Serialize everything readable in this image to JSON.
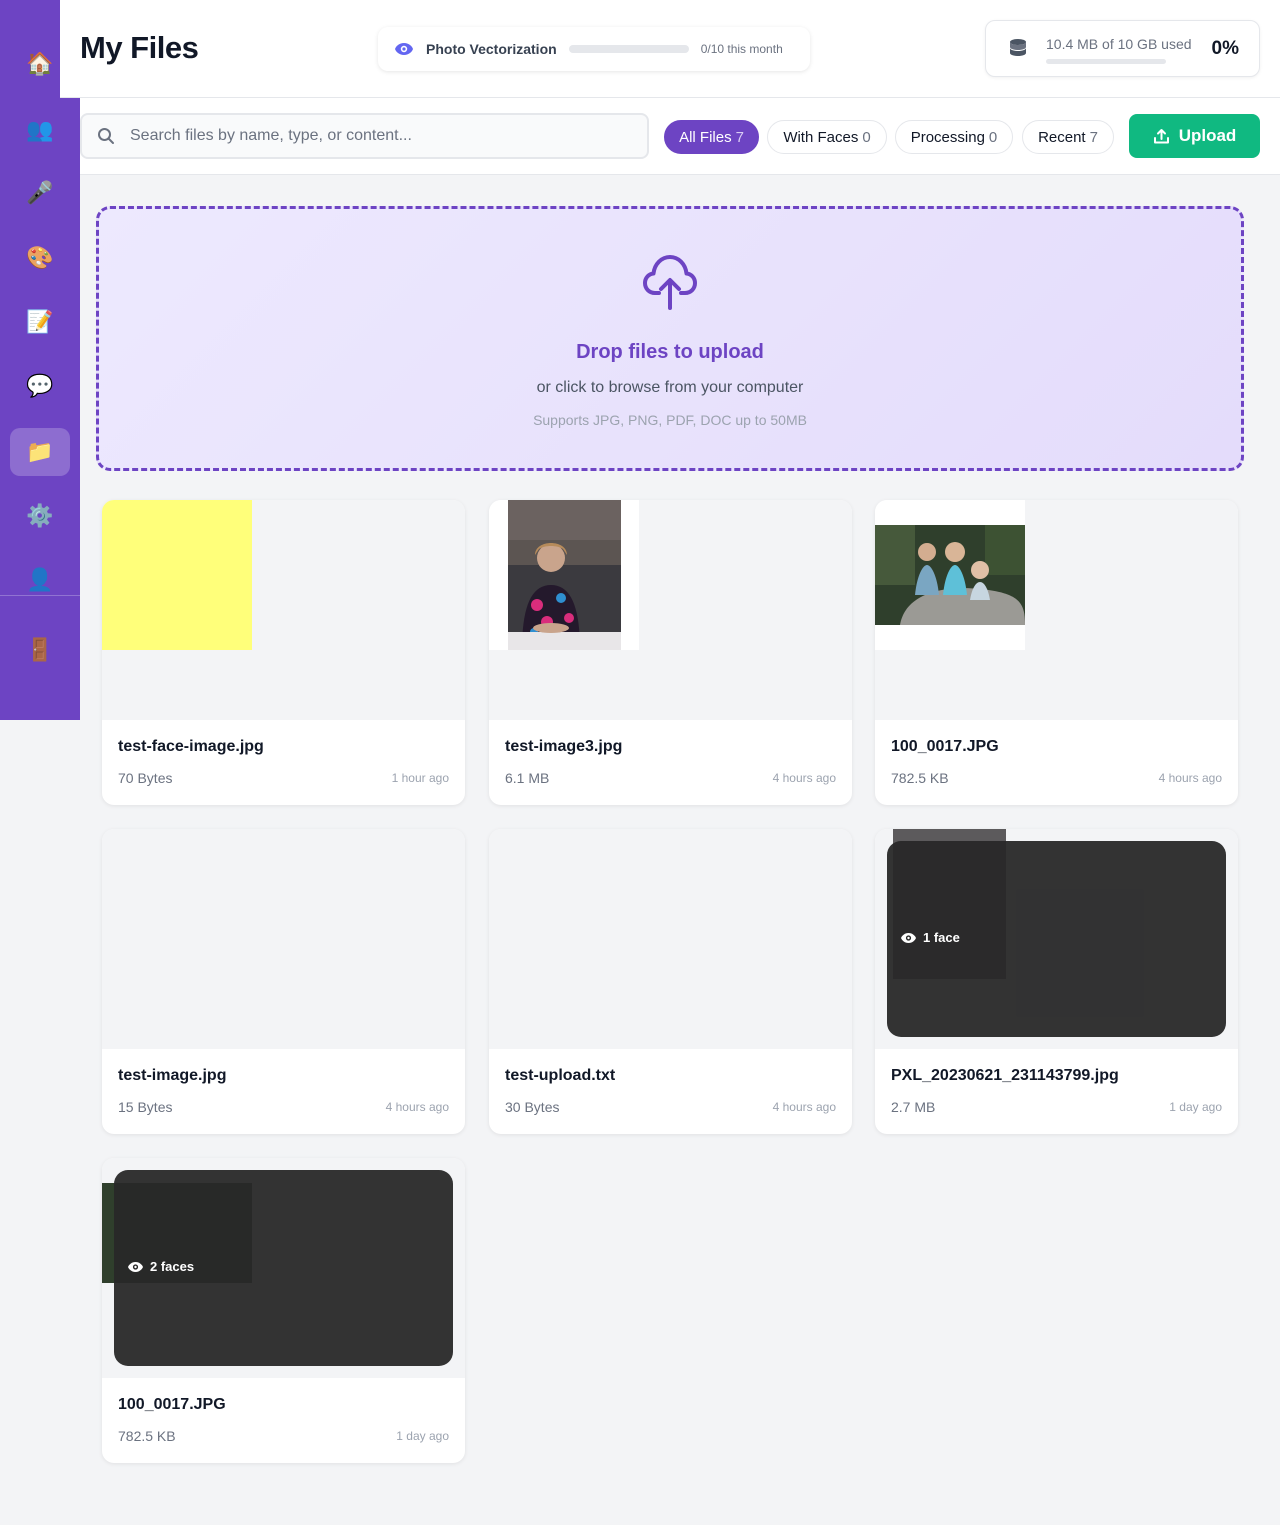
{
  "sidebar": {
    "items": [
      {
        "key": "home",
        "icon": "house-icon",
        "glyph": "🏠",
        "active": false
      },
      {
        "key": "people",
        "icon": "people-icon",
        "glyph": "👥",
        "active": false
      },
      {
        "key": "voice",
        "icon": "microphone-icon",
        "glyph": "🎤",
        "active": false
      },
      {
        "key": "art",
        "icon": "palette-icon",
        "glyph": "🎨",
        "active": false
      },
      {
        "key": "notes",
        "icon": "memo-icon",
        "glyph": "📝",
        "active": false
      },
      {
        "key": "chat",
        "icon": "speech-bubble-icon",
        "glyph": "💬",
        "active": false
      },
      {
        "key": "files",
        "icon": "folder-icon",
        "glyph": "📁",
        "active": true
      },
      {
        "key": "settings",
        "icon": "gear-icon",
        "glyph": "⚙️",
        "active": false
      },
      {
        "key": "profile",
        "icon": "user-icon",
        "glyph": "👤",
        "active": false
      },
      {
        "key": "logout",
        "icon": "door-icon",
        "glyph": "🚪",
        "active": false
      }
    ]
  },
  "header": {
    "title": "My Files",
    "vectorization": {
      "label": "Photo Vectorization",
      "count": "0/10 this month",
      "progress": 0
    },
    "storage": {
      "text": "10.4 MB of 10 GB used",
      "percent": "0%",
      "progress": 0
    }
  },
  "toolbar": {
    "search_placeholder": "Search files by name, type, or content...",
    "filters": [
      {
        "label": "All Files",
        "count": "7",
        "active": true
      },
      {
        "label": "With Faces",
        "count": "0",
        "active": false
      },
      {
        "label": "Processing",
        "count": "0",
        "active": false
      },
      {
        "label": "Recent",
        "count": "7",
        "active": false
      }
    ],
    "upload_label": "Upload"
  },
  "dropzone": {
    "title": "Drop files to upload",
    "subtitle": "or click to browse from your computer",
    "note": "Supports JPG, PNG, PDF, DOC up to 50MB"
  },
  "files": [
    {
      "name": "test-face-image.jpg",
      "size": "70 Bytes",
      "time": "1 hour ago",
      "faces": ""
    },
    {
      "name": "test-image3.jpg",
      "size": "6.1 MB",
      "time": "4 hours ago",
      "faces": ""
    },
    {
      "name": "100_0017.JPG",
      "size": "782.5 KB",
      "time": "4 hours ago",
      "faces": ""
    },
    {
      "name": "test-image.jpg",
      "size": "15 Bytes",
      "time": "4 hours ago",
      "faces": ""
    },
    {
      "name": "test-upload.txt",
      "size": "30 Bytes",
      "time": "4 hours ago",
      "faces": ""
    },
    {
      "name": "PXL_20230621_231143799.jpg",
      "size": "2.7 MB",
      "time": "1 day ago",
      "faces": "1 face"
    },
    {
      "name": "100_0017.JPG",
      "size": "782.5 KB",
      "time": "1 day ago",
      "faces": "2 faces"
    }
  ],
  "colors": {
    "brand": "#6d44c3",
    "upload": "#10b981",
    "vector_eye": "#6366f1"
  }
}
